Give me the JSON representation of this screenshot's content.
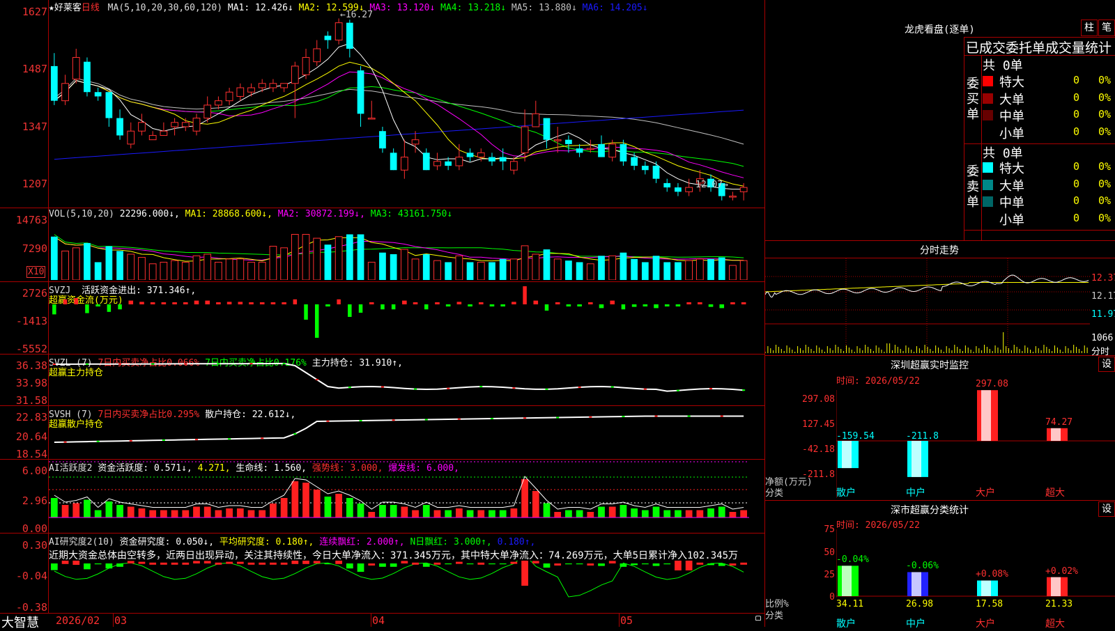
{
  "app": {
    "brand": "大智慧",
    "date_label": "2026/02",
    "month_labels": [
      "03",
      "04",
      "05"
    ]
  },
  "main": {
    "title": "★好莱客",
    "period": "日线",
    "ma_header": "MA(5,10,20,30,60,120)",
    "ma_values": [
      {
        "text": "MA1: 12.426↓",
        "color": "#ffffff"
      },
      {
        "text": "MA2: 12.599↓",
        "color": "#ffff00"
      },
      {
        "text": "MA3: 13.120↓",
        "color": "#ff00ff"
      },
      {
        "text": "MA4: 13.218↓",
        "color": "#00ff00"
      },
      {
        "text": "MA5: 13.880↓",
        "color": "#c0c0c0"
      },
      {
        "text": "MA6: 14.205↓",
        "color": "#1a1aff"
      }
    ],
    "axis": [
      "1627",
      "1487",
      "1347",
      "1207"
    ],
    "high_mark": "←16.27",
    "low_mark": "12.07→"
  },
  "vol": {
    "header": "VOL(5,10,20)",
    "value": "22296.000↓,",
    "ma1": "MA1: 28868.600↓,",
    "ma2": "MA2: 30872.199↓,",
    "ma3": "MA3: 43161.750↓",
    "axis": [
      "14763",
      "7290"
    ],
    "unit": "X10"
  },
  "svzj": {
    "header": "SVZJ",
    "line": "活跃资金进出: 371.346↑,",
    "sub": "超赢资金流(万元)",
    "axis": [
      "2726",
      "-1413",
      "-5552"
    ]
  },
  "svzl": {
    "header": "SVZL (7)",
    "a": "7日内买卖净占比0.066%",
    "b": "7日内买卖净占比0.176%",
    "c": "主力持仓: 31.910↑,",
    "sub": "超赢主力持仓",
    "axis": [
      "36.38",
      "33.98",
      "31.58"
    ]
  },
  "svsh": {
    "header": "SVSH (7)",
    "a": "7日内买卖净占比0.295%",
    "b": "散户持仓: 22.612↓,",
    "sub": "超赢散户持仓",
    "axis": [
      "22.83",
      "20.64",
      "18.54"
    ]
  },
  "ai2": {
    "header": "AI活跃度2",
    "a": "资金活跃度: 0.571↓,",
    "b": "4.271,",
    "c": "生命线: 1.560,",
    "d": "强势线: 3.000,",
    "e": "爆发线: 6.000,",
    "axis": [
      "6.00",
      "2.96",
      "0.00"
    ]
  },
  "ai_research": {
    "header": "AI研究度2(10)",
    "a": "资金研究度: 0.050↓,",
    "b": "平均研究度: 0.180↑,",
    "c": "连续飘红: 2.000↑,",
    "d": "N日飘红: 3.000↑,",
    "e": "0.180↑,",
    "note": "近期大资金总体由空转多，近两日出现异动，关注其持续性，今日大单净流入：371.345万元，其中特大单净流入：74.269万元，大单5日累计净入102.345万",
    "axis": [
      "0.30",
      "-0.04",
      "-0.38"
    ]
  },
  "lhb": {
    "title": "龙虎看盘(逐单)",
    "btn1": "柱",
    "btn2": "笔",
    "subtitle": "已成交委托单成交量统计",
    "buy_label": "委买单",
    "sell_label": "委卖单",
    "buy_total": "共 0单",
    "sell_total": "共 0单",
    "buy_rows": [
      {
        "name": "特大",
        "n": "0",
        "p": "0%",
        "color": "#ff0000"
      },
      {
        "name": "大单",
        "n": "0",
        "p": "0%",
        "color": "#990000"
      },
      {
        "name": "中单",
        "n": "0",
        "p": "0%",
        "color": "#660000"
      },
      {
        "name": "小单",
        "n": "0",
        "p": "0%",
        "color": ""
      }
    ],
    "sell_rows": [
      {
        "name": "特大",
        "n": "0",
        "p": "0%",
        "color": "#00ffff"
      },
      {
        "name": "大单",
        "n": "0",
        "p": "0%",
        "color": "#008888"
      },
      {
        "name": "中单",
        "n": "0",
        "p": "0%",
        "color": "#006666"
      },
      {
        "name": "小单",
        "n": "0",
        "p": "0%",
        "color": ""
      }
    ]
  },
  "fenshi": {
    "title": "分时走势",
    "axis": [
      "12.37",
      "12.17",
      "11.97"
    ],
    "vol": "1066",
    "vol_unit": "分时"
  },
  "sz_monitor": {
    "title": "深圳超赢实时监控",
    "btn": "设",
    "time": "时间: 2026/05/22",
    "axis": [
      "297.08",
      "127.45",
      "-42.18",
      "-211.8"
    ],
    "ylabel": "净额(万元)",
    "xlabel": "分类",
    "categories": [
      "散户",
      "中户",
      "大户",
      "超大"
    ],
    "values": [
      "-159.54",
      "-211.8",
      "297.08",
      "74.27"
    ]
  },
  "sz_class": {
    "title": "深市超赢分类统计",
    "btn": "设",
    "time": "时间: 2026/05/22",
    "axis": [
      "75",
      "50",
      "25",
      "0"
    ],
    "ylabel": "比例%",
    "xlabel": "分类",
    "categories": [
      "散户",
      "中户",
      "大户",
      "超大"
    ],
    "values": [
      "34.11",
      "26.98",
      "17.58",
      "21.33"
    ],
    "changes": [
      "-0.04%",
      "-0.06%",
      "+0.08%",
      "+0.02%"
    ]
  },
  "colors": {
    "up": "#ff3030",
    "down": "#00ffff",
    "grid": "#a00000",
    "axis_text": "#ff3333"
  },
  "chart_data": {
    "type": "candlestick",
    "title": "★好莱客 日线",
    "candles": [
      [
        15.2,
        14.4,
        15.5,
        14.3
      ],
      [
        14.4,
        14.8,
        15.0,
        14.3
      ],
      [
        14.9,
        15.4,
        15.6,
        14.8
      ],
      [
        15.3,
        14.6,
        15.4,
        14.5
      ],
      [
        14.6,
        14.5,
        14.7,
        14.4
      ],
      [
        14.6,
        14.0,
        14.6,
        13.8
      ],
      [
        14.0,
        13.6,
        14.2,
        13.5
      ],
      [
        13.4,
        13.7,
        13.9,
        13.3
      ],
      [
        13.7,
        13.9,
        14.1,
        13.6
      ],
      [
        13.5,
        13.6,
        13.7,
        13.5
      ],
      [
        13.6,
        13.7,
        13.9,
        13.6
      ],
      [
        13.8,
        13.9,
        14.0,
        13.6
      ],
      [
        13.8,
        13.9,
        14.0,
        13.7
      ],
      [
        13.7,
        14.0,
        14.1,
        13.6
      ],
      [
        14.0,
        14.3,
        14.5,
        13.9
      ],
      [
        14.3,
        14.4,
        14.5,
        14.2
      ],
      [
        14.4,
        14.6,
        14.7,
        14.3
      ],
      [
        14.5,
        14.7,
        14.8,
        14.4
      ],
      [
        14.6,
        14.7,
        14.8,
        14.5
      ],
      [
        14.7,
        14.8,
        14.9,
        14.6
      ],
      [
        14.7,
        14.8,
        14.9,
        14.6
      ],
      [
        14.7,
        14.8,
        14.8,
        14.6
      ],
      [
        14.8,
        15.2,
        15.3,
        14.0
      ],
      [
        15.0,
        15.4,
        15.6,
        14.9
      ],
      [
        15.3,
        15.6,
        15.8,
        15.2
      ],
      [
        15.9,
        15.8,
        16.0,
        15.6
      ],
      [
        15.8,
        16.2,
        16.3,
        15.7
      ],
      [
        16.2,
        15.6,
        16.27,
        15.4
      ],
      [
        15.1,
        14.1,
        15.2,
        13.8
      ],
      [
        14.0,
        14.0,
        14.4,
        14.0
      ],
      [
        13.7,
        13.3,
        13.8,
        13.2
      ],
      [
        13.2,
        12.8,
        13.3,
        12.8
      ],
      [
        12.8,
        13.1,
        13.5,
        12.6
      ],
      [
        13.4,
        13.5,
        13.7,
        13.2
      ],
      [
        13.2,
        12.8,
        13.3,
        12.8
      ],
      [
        12.9,
        13.0,
        13.2,
        12.8
      ],
      [
        13.0,
        12.9,
        13.1,
        12.8
      ],
      [
        12.9,
        13.1,
        13.4,
        12.8
      ],
      [
        13.2,
        13.1,
        13.3,
        13.0
      ],
      [
        13.1,
        13.2,
        13.3,
        13.0
      ],
      [
        13.1,
        13.0,
        13.2,
        12.9
      ],
      [
        13.1,
        13.0,
        13.3,
        12.8
      ],
      [
        12.8,
        13.0,
        13.1,
        12.7
      ],
      [
        13.2,
        13.8,
        14.2,
        13.0
      ],
      [
        13.8,
        14.1,
        14.4,
        13.8
      ],
      [
        14.0,
        13.5,
        14.0,
        13.3
      ],
      [
        13.5,
        13.5,
        13.8,
        13.2
      ],
      [
        13.5,
        13.4,
        13.6,
        13.2
      ],
      [
        13.3,
        13.2,
        13.4,
        13.1
      ],
      [
        13.3,
        13.3,
        13.5,
        13.2
      ],
      [
        13.4,
        13.1,
        13.6,
        13.1
      ],
      [
        13.1,
        13.4,
        13.5,
        13.0
      ],
      [
        13.4,
        13.0,
        13.5,
        12.9
      ],
      [
        13.1,
        12.9,
        13.2,
        12.8
      ],
      [
        12.9,
        12.8,
        13.0,
        12.7
      ],
      [
        12.9,
        12.6,
        13.0,
        12.5
      ],
      [
        12.5,
        12.4,
        12.6,
        12.3
      ],
      [
        12.4,
        12.3,
        12.5,
        12.2
      ],
      [
        12.3,
        12.4,
        12.6,
        12.2
      ],
      [
        12.5,
        12.6,
        12.8,
        12.3
      ],
      [
        12.6,
        12.4,
        12.7,
        12.3
      ],
      [
        12.5,
        12.2,
        12.5,
        12.1
      ],
      [
        12.2,
        12.2,
        12.3,
        12.1
      ],
      [
        12.3,
        12.4,
        12.5,
        12.1
      ]
    ],
    "ylim": [
      12.0,
      16.5
    ],
    "ma_values": {
      "MA1": 12.426,
      "MA2": 12.599,
      "MA3": 13.12,
      "MA4": 13.218,
      "MA5": 13.88,
      "MA6": 14.205
    }
  }
}
